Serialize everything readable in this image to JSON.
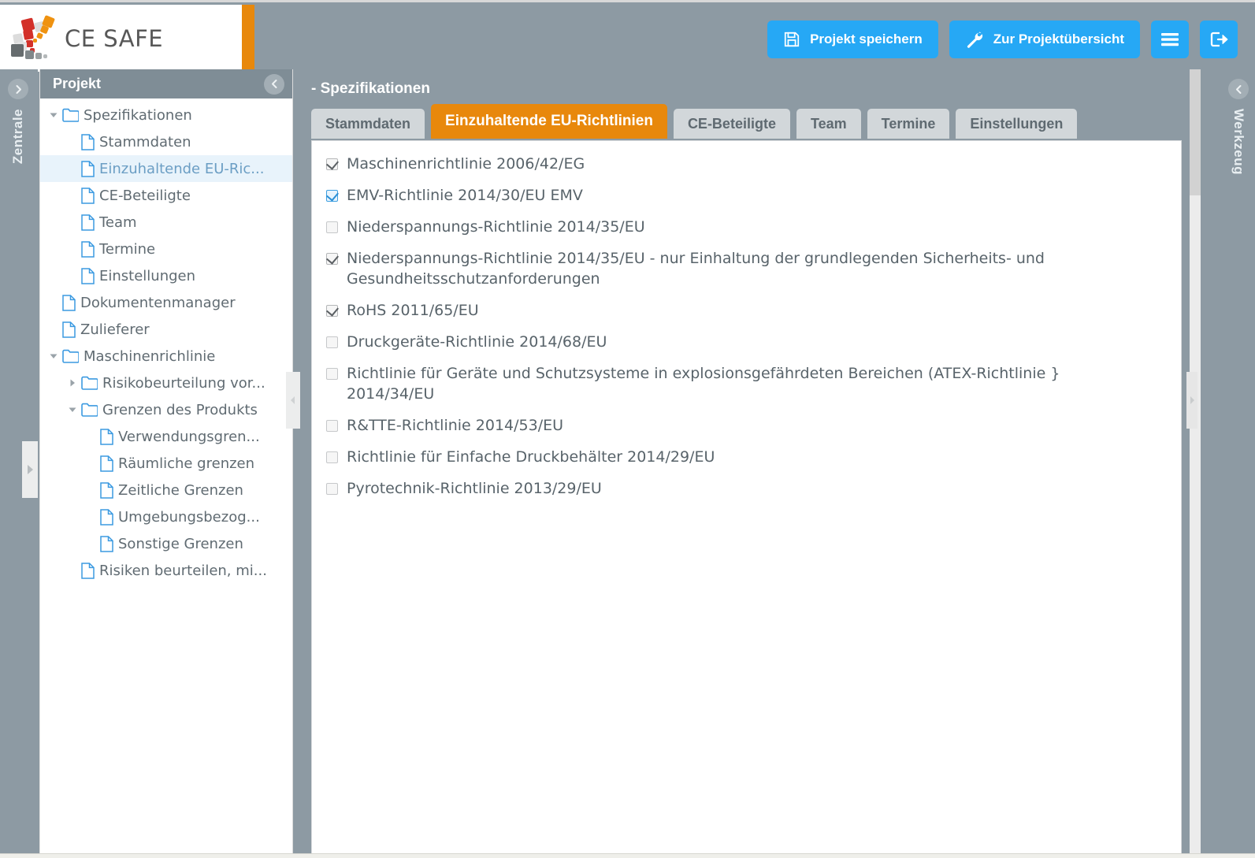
{
  "app": {
    "brand": "CE SAFE",
    "accent_orange": "#e8880c",
    "accent_blue": "#26a8f5",
    "chrome_gray": "#8d9aa3"
  },
  "topbar": {
    "buttons": [
      {
        "id": "save-project",
        "label": "Projekt speichern",
        "icon": "floppy-disk-icon"
      },
      {
        "id": "project-overview",
        "label": "Zur Projektübersicht",
        "icon": "wrench-icon"
      },
      {
        "id": "menu",
        "label": "",
        "icon": "hamburger-menu-icon"
      },
      {
        "id": "logout",
        "label": "",
        "icon": "logout-icon"
      }
    ]
  },
  "rails": {
    "left": {
      "label": "Zentrale",
      "toggle_icon": "chevron-right-circle-icon"
    },
    "right": {
      "label": "Werkzeug",
      "toggle_icon": "chevron-left-circle-icon"
    }
  },
  "sidebar": {
    "title": "Projekt",
    "collapse_icon": "chevron-left-circle-icon",
    "tree": [
      {
        "label": "Spezifikationen",
        "type": "folder",
        "indent": 0,
        "twisty": "down",
        "selected": false
      },
      {
        "label": "Stammdaten",
        "type": "file",
        "indent": 1,
        "twisty": "none",
        "selected": false
      },
      {
        "label": "Einzuhaltende EU-Ric...",
        "type": "file",
        "indent": 1,
        "twisty": "none",
        "selected": true
      },
      {
        "label": "CE-Beteiligte",
        "type": "file",
        "indent": 1,
        "twisty": "none",
        "selected": false
      },
      {
        "label": "Team",
        "type": "file",
        "indent": 1,
        "twisty": "none",
        "selected": false
      },
      {
        "label": "Termine",
        "type": "file",
        "indent": 1,
        "twisty": "none",
        "selected": false
      },
      {
        "label": "Einstellungen",
        "type": "file",
        "indent": 1,
        "twisty": "none",
        "selected": false
      },
      {
        "label": "Dokumentenmanager",
        "type": "file",
        "indent": 0,
        "twisty": "none",
        "selected": false
      },
      {
        "label": "Zulieferer",
        "type": "file",
        "indent": 0,
        "twisty": "none",
        "selected": false
      },
      {
        "label": "Maschinenrichlinie",
        "type": "folder",
        "indent": 0,
        "twisty": "down",
        "selected": false
      },
      {
        "label": "Risikobeurteilung vor...",
        "type": "folder",
        "indent": 1,
        "twisty": "right",
        "selected": false
      },
      {
        "label": "Grenzen des Produkts",
        "type": "folder",
        "indent": 1,
        "twisty": "down",
        "selected": false
      },
      {
        "label": "Verwendungsgren...",
        "type": "file",
        "indent": 2,
        "twisty": "none",
        "selected": false
      },
      {
        "label": "Räumliche grenzen",
        "type": "file",
        "indent": 2,
        "twisty": "none",
        "selected": false
      },
      {
        "label": "Zeitliche Grenzen",
        "type": "file",
        "indent": 2,
        "twisty": "none",
        "selected": false
      },
      {
        "label": "Umgebungsbezog...",
        "type": "file",
        "indent": 2,
        "twisty": "none",
        "selected": false
      },
      {
        "label": "Sonstige Grenzen",
        "type": "file",
        "indent": 2,
        "twisty": "none",
        "selected": false
      },
      {
        "label": "Risiken beurteilen, mi...",
        "type": "file",
        "indent": 1,
        "twisty": "none",
        "selected": false
      }
    ]
  },
  "main": {
    "breadcrumb": "- Spezifikationen",
    "tabs": [
      {
        "label": "Stammdaten",
        "active": false
      },
      {
        "label": "Einzuhaltende EU-Richtlinien",
        "active": true
      },
      {
        "label": "CE-Beteiligte",
        "active": false
      },
      {
        "label": "Team",
        "active": false
      },
      {
        "label": "Termine",
        "active": false
      },
      {
        "label": "Einstellungen",
        "active": false
      }
    ],
    "directives": [
      {
        "label": "Maschinenrichtlinie 2006/42/EG",
        "checked": true,
        "style": "gray"
      },
      {
        "label": "EMV-Richtlinie 2014/30/EU EMV",
        "checked": true,
        "style": "blue"
      },
      {
        "label": "Niederspannungs-Richtlinie 2014/35/EU",
        "checked": false,
        "style": "gray"
      },
      {
        "label": "Niederspannungs-Richtlinie 2014/35/EU - nur Einhaltung der grundlegenden Sicherheits- und Gesundheitsschutzanforderungen",
        "checked": true,
        "style": "gray"
      },
      {
        "label": "RoHS 2011/65/EU",
        "checked": true,
        "style": "gray"
      },
      {
        "label": "Druckgeräte-Richtlinie 2014/68/EU",
        "checked": false,
        "style": "gray"
      },
      {
        "label": "Richtlinie für Geräte und Schutzsysteme in explosionsgefährdeten Bereichen (ATEX-Richtlinie } 2014/34/EU",
        "checked": false,
        "style": "gray"
      },
      {
        "label": "R&TTE-Richtlinie 2014/53/EU",
        "checked": false,
        "style": "gray"
      },
      {
        "label": "Richtlinie für Einfache Druckbehälter 2014/29/EU",
        "checked": false,
        "style": "gray"
      },
      {
        "label": "Pyrotechnik-Richtlinie 2013/29/EU",
        "checked": false,
        "style": "gray"
      }
    ]
  }
}
